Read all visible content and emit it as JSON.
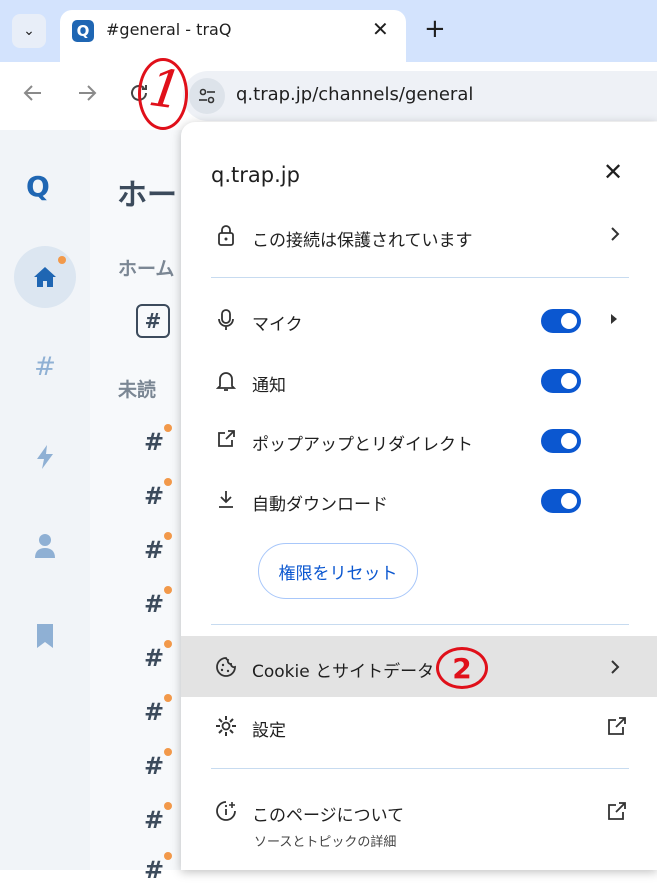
{
  "browser": {
    "tab_title": "#general - traQ",
    "favicon_letter": "Q",
    "tab_close": "✕",
    "new_tab": "+",
    "tab_search": "⌄",
    "url": "q.trap.jp/channels/general"
  },
  "traq": {
    "logo": "Q",
    "header": "ホー",
    "home_section": "ホーム",
    "unread_section": "未読",
    "hash": "#"
  },
  "site_info": {
    "domain": "q.trap.jp",
    "close": "✕",
    "connection": "この接続は保護されています",
    "permissions": [
      {
        "label": "マイク",
        "enabled": true
      },
      {
        "label": "通知",
        "enabled": true
      },
      {
        "label": "ポップアップとリダイレクト",
        "enabled": true
      },
      {
        "label": "自動ダウンロード",
        "enabled": true
      }
    ],
    "reset_button": "権限をリセット",
    "cookies": "Cookie とサイトデータ",
    "settings": "設定",
    "about_page": "このページについて",
    "about_sub": "ソースとトピックの詳細"
  },
  "annotations": {
    "step1": "1",
    "step2": "2",
    "color": "#e0101a"
  },
  "colors": {
    "toggle_on": "#0b57d0",
    "tabstrip": "#d3e3fd",
    "unread_dot": "#f2994a"
  }
}
